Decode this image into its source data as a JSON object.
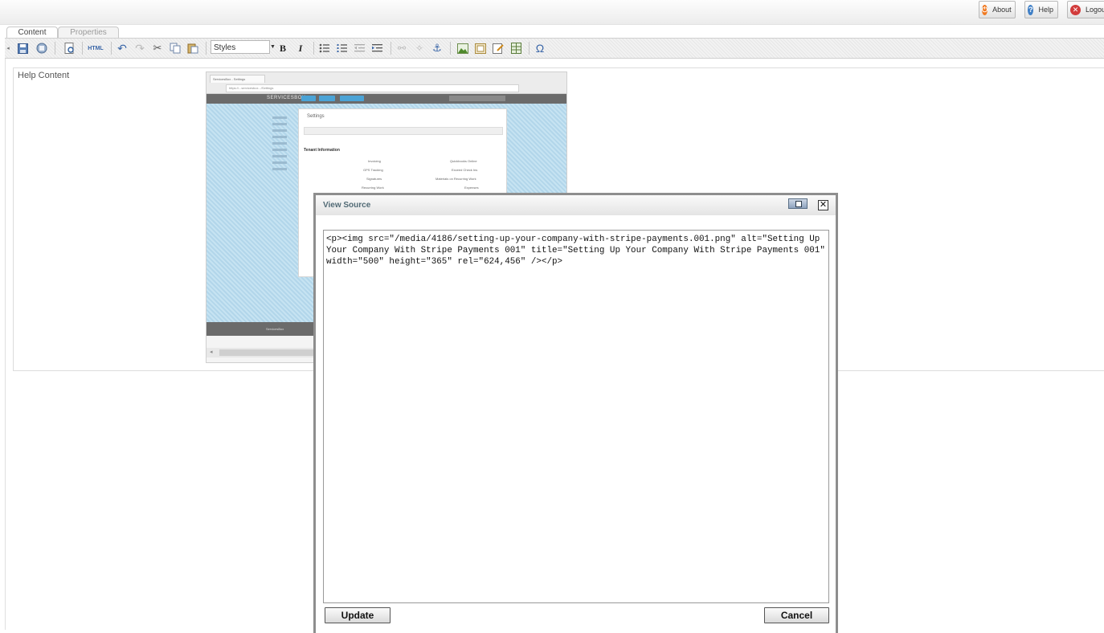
{
  "header": {
    "buttons": [
      {
        "label": "About",
        "icon": "power-icon",
        "color": "#f07a22"
      },
      {
        "label": "Help",
        "icon": "question-icon",
        "color": "#3f7fc6"
      },
      {
        "label": "Logout",
        "icon": "close-circle-icon",
        "color": "#d23c3c"
      }
    ]
  },
  "tabs": [
    {
      "label": "Content",
      "active": true
    },
    {
      "label": "Properties",
      "active": false
    }
  ],
  "toolbar": {
    "html_label": "HTML",
    "styles_value": "Styles",
    "bold_label": "B",
    "italic_label": "I",
    "omega_label": "Ω"
  },
  "editor": {
    "help_label": "Help Content"
  },
  "embedded_screenshot": {
    "tab_text": "ServicesBox - Settings",
    "url_text": "https://...servicesbox.../Settings",
    "logo": "SERVICESBOX",
    "panel_title": "Settings",
    "section_title": "Tenant Information",
    "rows": [
      {
        "label": "Invoicing",
        "right": "Quickbooks Online"
      },
      {
        "label": "GPS Tracking",
        "right": "Exceed Check Ins"
      },
      {
        "label": "Signatures",
        "right": "Materials on Recurring Work"
      },
      {
        "label": "Recurring Work",
        "right": "Expenses"
      }
    ],
    "footer_text": "ServicesBox"
  },
  "dialog": {
    "title": "View Source",
    "source": "<p><img src=\"/media/4186/setting-up-your-company-with-stripe-payments.001.png\" alt=\"Setting Up Your Company With Stripe Payments 001\" title=\"Setting Up Your Company With Stripe Payments 001\" width=\"500\" height=\"365\" rel=\"624,456\" /></p>",
    "update_label": "Update",
    "cancel_label": "Cancel",
    "close_glyph": "✕"
  }
}
